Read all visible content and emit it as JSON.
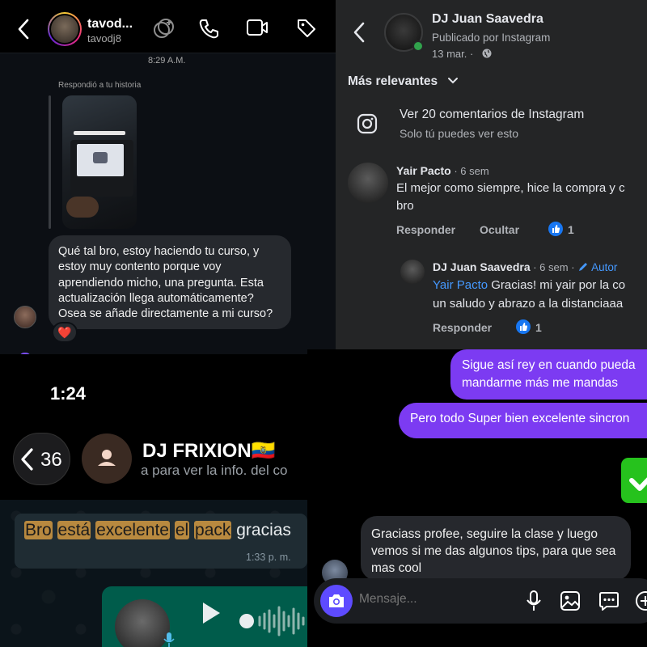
{
  "instagram_dm": {
    "username": "tavod...",
    "handle": "tavodj8",
    "time_separator": "8:29 A.M.",
    "reply_note": "Respondió a tu historia",
    "message": "Qué tal bro, estoy haciendo tu curso, y estoy muy contento porque voy aprendiendo micho, una pregunta. Esta actualización llega automáticamente? Osea se añade directamente a mi curso?",
    "reaction": "❤️",
    "icons": [
      "back-arrow-icon",
      "effects-icon",
      "phone-icon",
      "video-icon",
      "tag-icon"
    ]
  },
  "facebook_post": {
    "page_name": "DJ Juan Saavedra",
    "subtitle": "Publicado por Instagram",
    "date": "13 mar. ·",
    "sort_label": "Más relevantes",
    "ig_link": "Ver 20 comentarios de Instagram",
    "ig_note": "Solo tú puedes ver esto",
    "comments": [
      {
        "name": "Yair Pacto",
        "meta": " · 6 sem",
        "text_line1": "El mejor como siempre, hice la compra y c",
        "text_line2": "bro",
        "reply_label": "Responder",
        "hide_label": "Ocultar",
        "likes": "1"
      },
      {
        "name": "DJ Juan Saavedra",
        "meta": " · 6 sem · ",
        "author_badge": "Autor",
        "mention": "Yair Pacto",
        "text_line1_rest": " Gracias! mi yair por la co",
        "text_line2": "un saludo y abrazo a la distanciaaa",
        "reply_label": "Responder",
        "likes": "1"
      }
    ]
  },
  "whatsapp": {
    "clock": "1:24",
    "back_count": "36",
    "contact_name": "DJ FRIXION🇪🇨",
    "contact_hint": "a para ver la info. del co",
    "message_words": [
      "Bro",
      "está",
      "excelente",
      "el",
      "pack"
    ],
    "message_tail": "gracias",
    "message_time": "1:33 p. m."
  },
  "messenger": {
    "outgoing": [
      {
        "line1": "Sigue así rey en cuando pueda",
        "line2": "mandarme más me mandas"
      },
      {
        "line1": "Pero todo Super bien excelente sincron"
      }
    ],
    "incoming": "Graciass profee, seguire la clase y luego vemos si me das algunos tips, para que sea mas cool",
    "composer_placeholder": "Mensaje...",
    "accent": "#7c3bf2"
  }
}
